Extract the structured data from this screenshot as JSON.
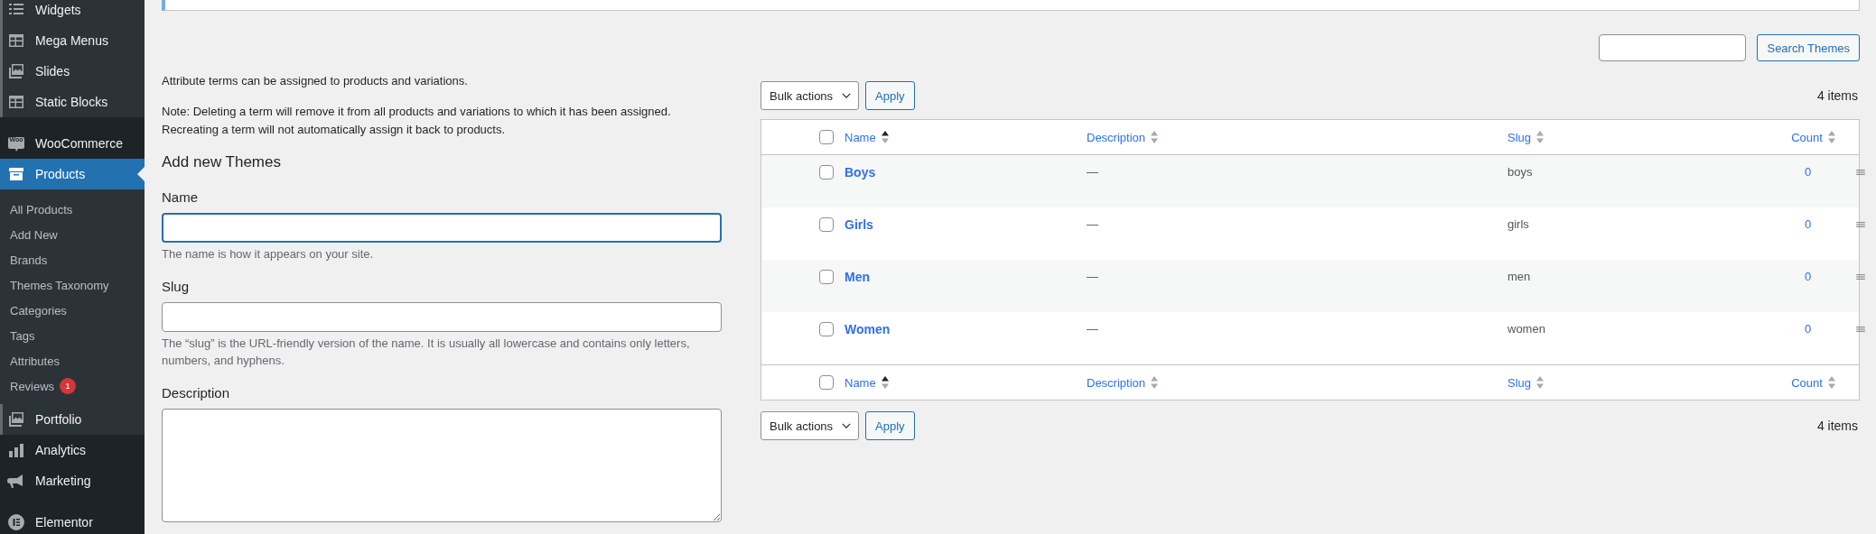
{
  "sidebar": {
    "items": [
      {
        "label": "Widgets",
        "highlighted": true,
        "selected": false
      },
      {
        "label": "Mega Menus",
        "highlighted": true,
        "selected": false
      },
      {
        "label": "Slides",
        "highlighted": true,
        "selected": false
      },
      {
        "label": "Static Blocks",
        "highlighted": true,
        "selected": false
      },
      {
        "label": "WooCommerce",
        "icon_text": "Woo",
        "highlighted": false,
        "selected": false
      },
      {
        "label": "Products",
        "highlighted": false,
        "selected": true,
        "children": [
          {
            "label": "All Products"
          },
          {
            "label": "Add New"
          },
          {
            "label": "Brands"
          },
          {
            "label": "Themes Taxonomy"
          },
          {
            "label": "Categories"
          },
          {
            "label": "Tags"
          },
          {
            "label": "Attributes"
          },
          {
            "label": "Reviews",
            "badge": "1"
          }
        ]
      },
      {
        "label": "Portfolio",
        "highlighted": true,
        "selected": false
      },
      {
        "label": "Analytics",
        "highlighted": false,
        "selected": false
      },
      {
        "label": "Marketing",
        "highlighted": false,
        "selected": false
      },
      {
        "label": "Elementor",
        "highlighted": false,
        "selected": false
      }
    ]
  },
  "form": {
    "intro": "Attribute terms can be assigned to products and variations.",
    "note": "Note: Deleting a term will remove it from all products and variations to which it has been assigned. Recreating a term will not automatically assign it back to products.",
    "heading": "Add new Themes",
    "fields": [
      {
        "kind": "input",
        "label": "Name",
        "focused": true,
        "hint": "The name is how it appears on your site."
      },
      {
        "kind": "input",
        "label": "Slug",
        "focused": false,
        "hint": "The “slug” is the URL-friendly version of the name. It is usually all lowercase and contains only letters, numbers, and hyphens."
      },
      {
        "kind": "textarea",
        "label": "Description",
        "focused": false
      }
    ]
  },
  "search": {
    "button": "Search Themes"
  },
  "top_actions": {
    "select": "Bulk actions",
    "button": "Apply",
    "count": "4 items"
  },
  "table": {
    "header_checked": false,
    "columns": [
      {
        "label": "Name",
        "sorted": true
      },
      {
        "label": "Description",
        "sorted": false
      },
      {
        "label": "Slug",
        "sorted": false
      },
      {
        "label": "Count",
        "sorted": false
      }
    ],
    "rows": [
      {
        "name": "Boys",
        "description": "—",
        "slug": "boys",
        "count": "0",
        "checked": false
      },
      {
        "name": "Girls",
        "description": "—",
        "slug": "girls",
        "count": "0",
        "checked": false
      },
      {
        "name": "Men",
        "description": "—",
        "slug": "men",
        "count": "0",
        "checked": false
      },
      {
        "name": "Women",
        "description": "—",
        "slug": "women",
        "count": "0",
        "checked": false
      }
    ],
    "footer_checked": false,
    "footer_columns": [
      {
        "label": "Name",
        "sorted": true
      },
      {
        "label": "Description",
        "sorted": false
      },
      {
        "label": "Slug",
        "sorted": false
      },
      {
        "label": "Count",
        "sorted": false
      }
    ]
  },
  "bottom_actions": {
    "select": "Bulk actions",
    "button": "Apply",
    "count": "4 items"
  }
}
